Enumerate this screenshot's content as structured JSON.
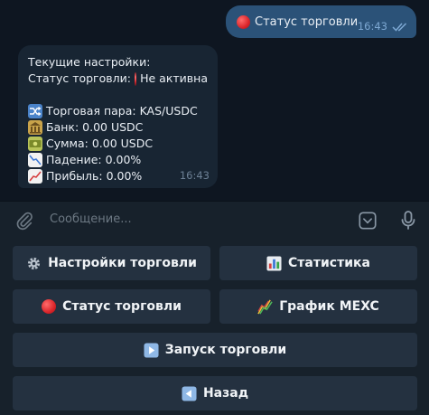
{
  "chat": {
    "outgoing": {
      "text": "Статус торговли",
      "time": "16:43"
    },
    "incoming": {
      "line1": "Текущие настройки:",
      "line2_prefix": "Статус торговли:",
      "line2_status": "Не активна",
      "pair": "Торговая пара: KAS/USDC",
      "bank": "Банк: 0.00 USDC",
      "sum": "Сумма: 0.00 USDC",
      "drop": "Падение: 0.00%",
      "profit": "Прибыль: 0.00%",
      "time": "16:43"
    }
  },
  "composer": {
    "placeholder": "Сообщение..."
  },
  "keyboard": {
    "trade_settings": "Настройки торговли",
    "statistics": "Статистика",
    "trade_status": "Статус торговли",
    "mexc_chart": "График MEXC",
    "start_trading": "Запуск торговли",
    "back": "Назад"
  },
  "colors": {
    "background": "#0e1621",
    "outgoing_bubble": "#2b5278",
    "incoming_bubble": "#182533",
    "keyboard_button": "#243140",
    "status_red": "#d9252a"
  }
}
